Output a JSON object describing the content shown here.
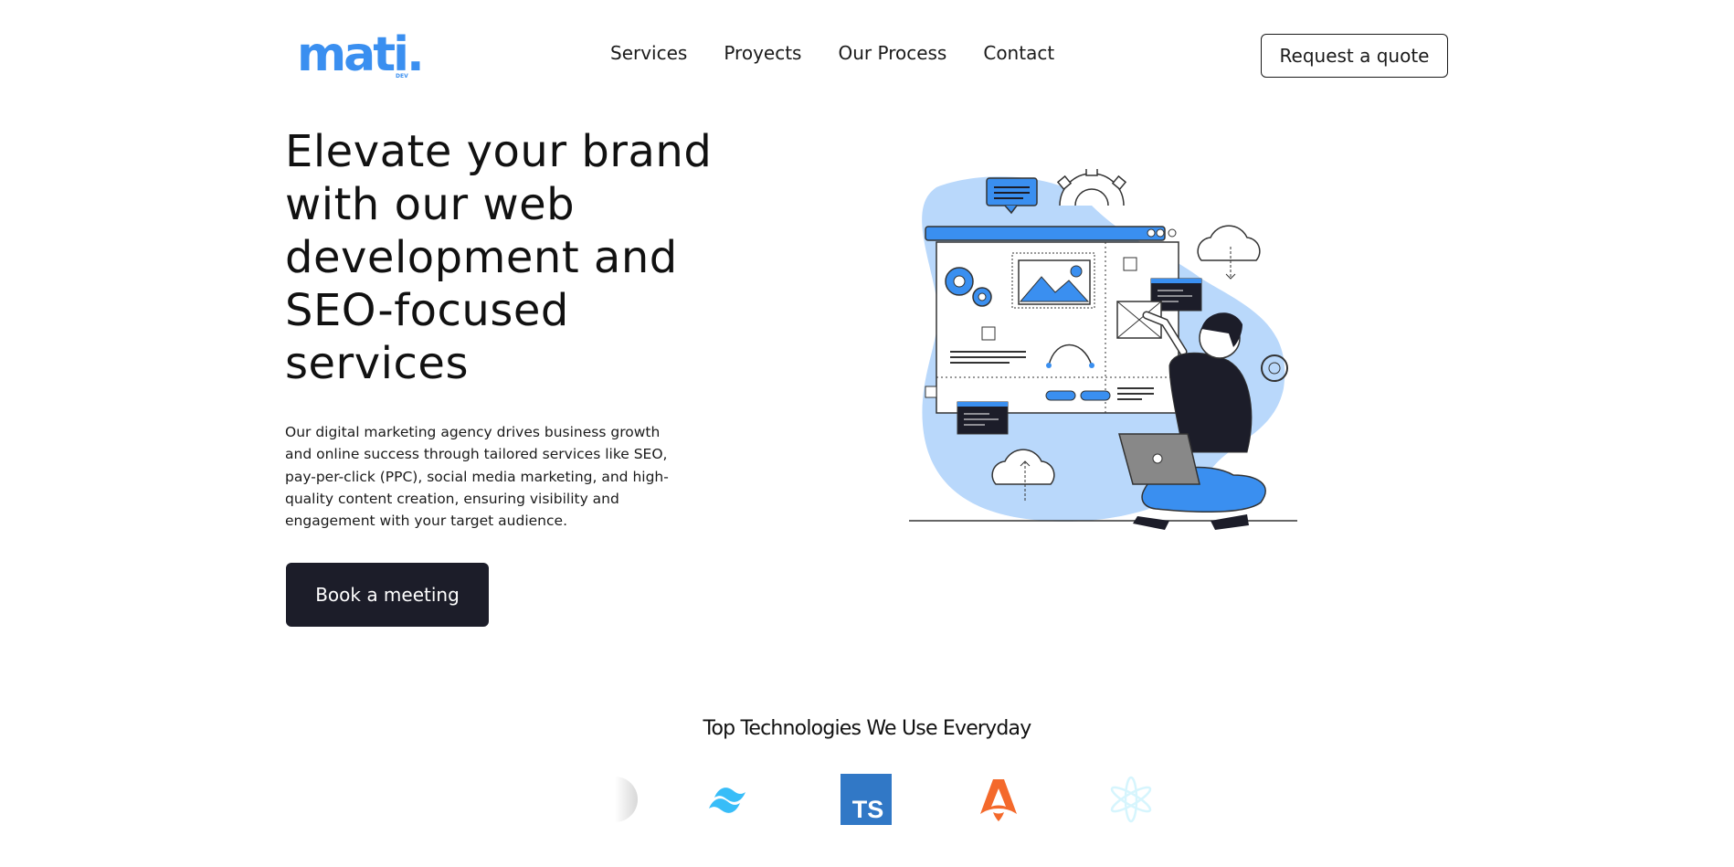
{
  "header": {
    "logo_text": "mati.",
    "logo_sub": "DEV",
    "nav": [
      "Services",
      "Proyects",
      "Our Process",
      "Contact"
    ],
    "quote_button": "Request a quote"
  },
  "hero": {
    "title": "Elevate your brand with our web development and SEO-focused services",
    "description": "Our digital marketing agency drives business growth and online success through tailored services like SEO, pay-per-click (PPC), social media marketing, and high-quality content creation, ensuring visibility and engagement with your target audience.",
    "cta": "Book a meeting"
  },
  "technologies": {
    "title": "Top Technologies We Use Everyday",
    "logos": [
      "partial-circle-logo",
      "tailwind-logo",
      "typescript-logo",
      "astro-logo",
      "react-logo"
    ],
    "ts_label": "TS"
  },
  "colors": {
    "accent": "#3a8ff0",
    "light_blue": "#b9d8fb",
    "dark": "#1c1d29",
    "tailwind": "#38bdf8",
    "typescript": "#3178c6",
    "astro": "#f4692b"
  }
}
